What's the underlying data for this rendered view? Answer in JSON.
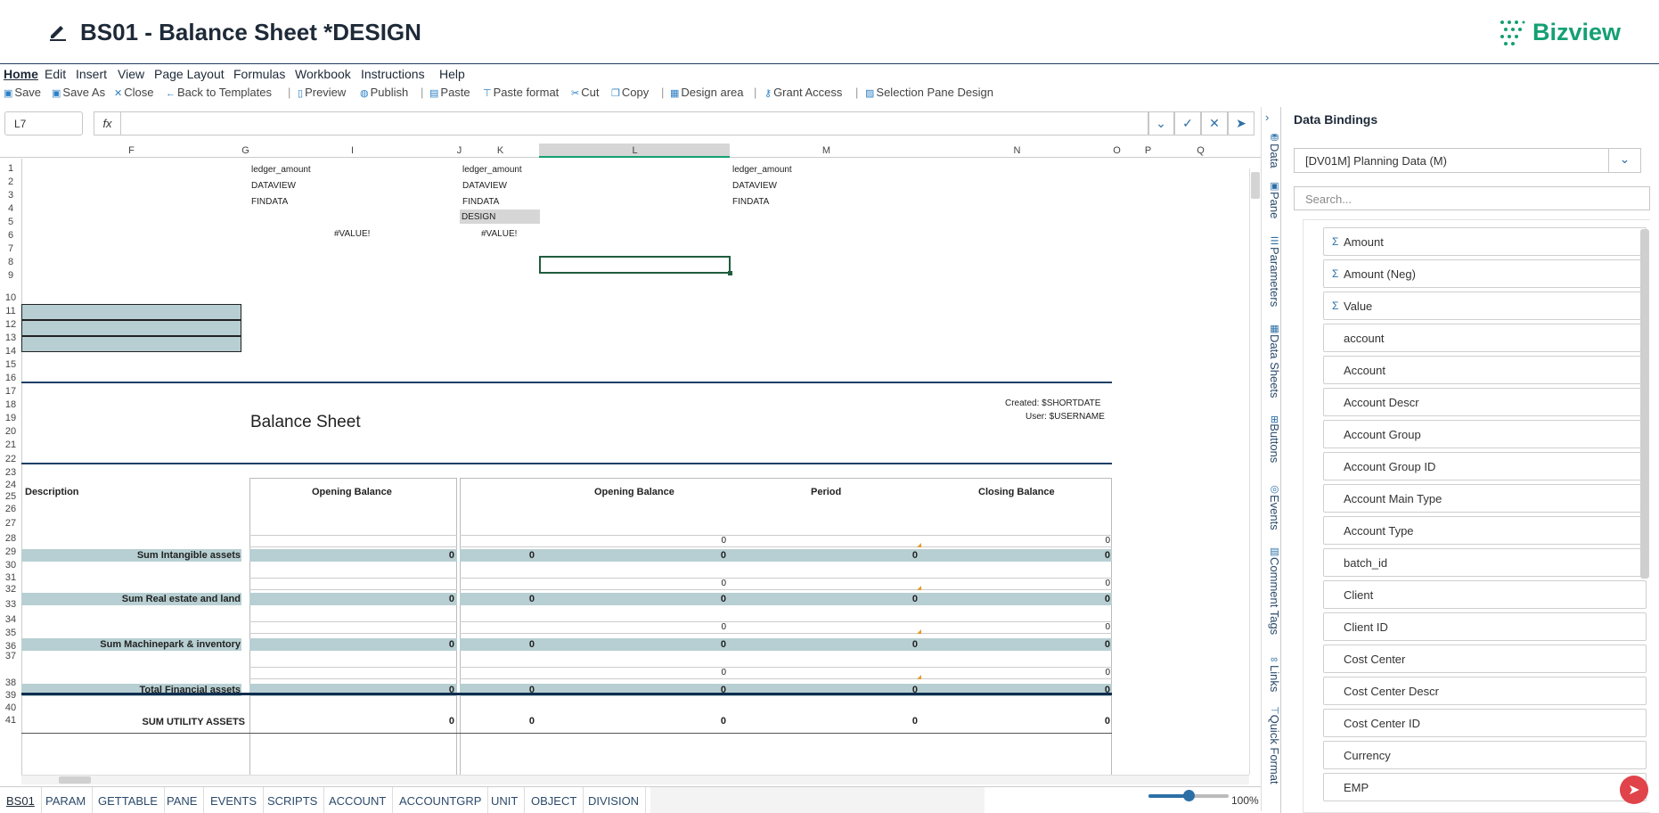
{
  "header": {
    "title": "BS01 - Balance Sheet *DESIGN",
    "logo_text": "Bizview"
  },
  "menu": [
    "Home",
    "Edit",
    "Insert",
    "View",
    "Page Layout",
    "Formulas",
    "Workbook",
    "Instructions",
    "Help"
  ],
  "toolbar": {
    "save": "Save",
    "save_as": "Save As",
    "close": "Close",
    "back": "Back to Templates",
    "preview": "Preview",
    "publish": "Publish",
    "paste": "Paste",
    "paste_format": "Paste format",
    "cut": "Cut",
    "copy": "Copy",
    "design_area": "Design area",
    "grant_access": "Grant Access",
    "selection_pane": "Selection Pane Design"
  },
  "formula_bar": {
    "name_box": "L7",
    "fx": "fx",
    "value": ""
  },
  "columns": [
    "F",
    "G",
    "I",
    "J",
    "K",
    "L",
    "M",
    "N",
    "O",
    "P",
    "Q"
  ],
  "rows": [
    "1",
    "2",
    "3",
    "4",
    "5",
    "6",
    "7",
    "8",
    "9",
    "10",
    "11",
    "12",
    "13",
    "14",
    "15",
    "16",
    "17",
    "18",
    "19",
    "20",
    "21",
    "22",
    "23",
    "24",
    "25",
    "26",
    "27",
    "28",
    "29",
    "30",
    "31",
    "32",
    "33",
    "34",
    "35",
    "36",
    "37",
    "38",
    "39",
    "40",
    "41"
  ],
  "cells": {
    "i1": "ledger_amount",
    "i2": "DATAVIEW",
    "i3": "FINDATA",
    "k1": "ledger_amount",
    "k2": "DATAVIEW",
    "k3": "FINDATA",
    "k4": "DESIGN",
    "m1": "ledger_amount",
    "m2": "DATAVIEW",
    "m3": "FINDATA",
    "i5": "#VALUE!",
    "k5": "#VALUE!",
    "sheet_title": "Balance Sheet",
    "created": "Created: $SHORTDATE",
    "user": "User: $USERNAME",
    "h_desc": "Description",
    "h_ob1": "Opening Balance",
    "h_ob2": "Opening Balance",
    "h_period": "Period",
    "h_cb": "Closing Balance",
    "sum1": "Sum Intangible assets",
    "sum2": "Sum Real estate and land",
    "sum3": "Sum Machinepark & inventory",
    "sum4": "Total Financial assets",
    "sum5": "SUM UTILITY ASSETS",
    "zero": "0"
  },
  "sheet_tabs": [
    "BS01",
    "PARAM",
    "GETTABLE",
    "PANE",
    "EVENTS",
    "SCRIPTS",
    "ACCOUNT",
    "ACCOUNTGRP",
    "UNIT",
    "OBJECT",
    "DIVISION"
  ],
  "zoom": {
    "label": "100%",
    "level": 0.5
  },
  "side_tabs": [
    "Data",
    "Pane",
    "Parameters",
    "Data Sheets",
    "Buttons",
    "Events",
    "Comment Tags",
    "Links",
    "Quick Format"
  ],
  "panel": {
    "title": "Data Bindings",
    "source": "[DV01M] Planning Data (M)",
    "search_placeholder": "Search...",
    "fields": [
      {
        "label": "Amount",
        "measure": true
      },
      {
        "label": "Amount (Neg)",
        "measure": true
      },
      {
        "label": "Value",
        "measure": true
      },
      {
        "label": "account"
      },
      {
        "label": "Account"
      },
      {
        "label": "Account Descr"
      },
      {
        "label": "Account Group"
      },
      {
        "label": "Account Group ID"
      },
      {
        "label": "Account Main Type"
      },
      {
        "label": "Account Type"
      },
      {
        "label": "batch_id"
      },
      {
        "label": "Client"
      },
      {
        "label": "Client ID"
      },
      {
        "label": "Cost Center"
      },
      {
        "label": "Cost Center Descr"
      },
      {
        "label": "Cost Center ID"
      },
      {
        "label": "Currency"
      },
      {
        "label": "EMP"
      }
    ]
  },
  "colors": {
    "accent": "#1f3f66",
    "brand": "#14a073",
    "band": "#b7cfd2",
    "link": "#2c6fa6"
  }
}
